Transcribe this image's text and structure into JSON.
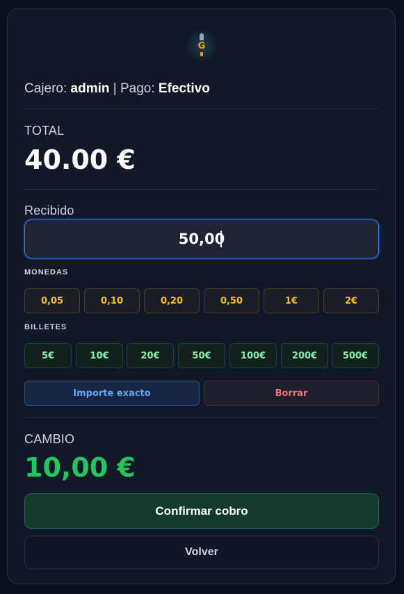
{
  "header": {
    "logo_letter": "G",
    "cashier_label": "Cajero:",
    "cashier_name": "admin",
    "separator": "|",
    "payment_label": "Pago:",
    "payment_method": "Efectivo"
  },
  "total": {
    "label": "TOTAL",
    "value": "40.00 €"
  },
  "received": {
    "label": "Recibido",
    "value": "50,00"
  },
  "coins": {
    "label": "MONEDAS",
    "items": [
      "0,05",
      "0,10",
      "0,20",
      "0,50",
      "1€",
      "2€"
    ]
  },
  "bills": {
    "label": "BILLETES",
    "items": [
      "5€",
      "10€",
      "20€",
      "50€",
      "100€",
      "200€",
      "500€"
    ]
  },
  "actions": {
    "exact_label": "Importe exacto",
    "clear_label": "Borrar"
  },
  "change": {
    "label": "CAMBIO",
    "value": "10,00 €"
  },
  "footer": {
    "confirm_label": "Confirmar cobro",
    "back_label": "Volver"
  },
  "colors": {
    "accent_blue": "#3b82f6",
    "coin_gold": "#fbbf24",
    "bill_green": "#86efac",
    "change_green": "#22c55e",
    "danger_red": "#f87171"
  }
}
